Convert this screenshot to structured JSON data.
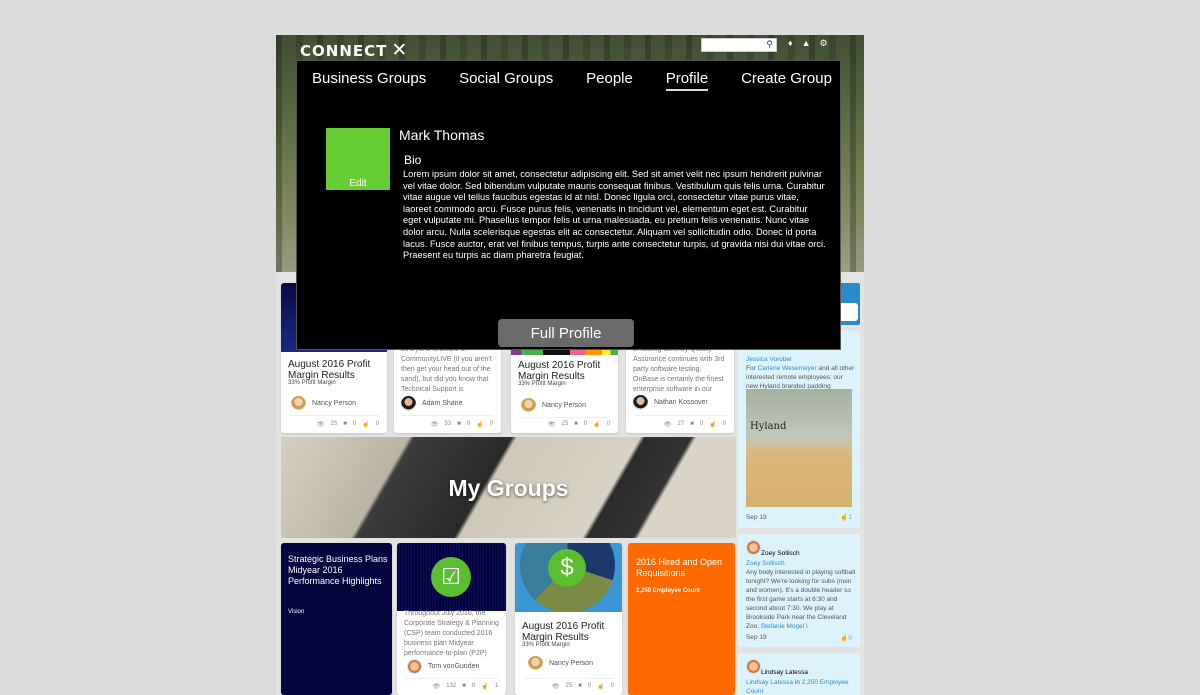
{
  "header": {
    "logo": "CONNECT",
    "logo_mark": "✕",
    "search_placeholder": "",
    "icons": [
      "bell-icon",
      "user-icon",
      "gear-icon"
    ]
  },
  "overlay": {
    "nav": [
      {
        "label": "Business Groups",
        "active": false
      },
      {
        "label": "Social Groups",
        "active": false
      },
      {
        "label": "People",
        "active": false
      },
      {
        "label": "Profile",
        "active": true
      },
      {
        "label": "Create Group",
        "active": false
      }
    ],
    "profile": {
      "photo_edit_label": "Edit",
      "photo_color": "#66cc33",
      "name": "Mark Thomas",
      "bio_label": "Bio",
      "bio": "Lorem ipsum dolor sit amet, consectetur adipiscing elit. Sed sit amet velit nec ipsum hendrerit pulvinar vel vitae dolor. Sed bibendum vulputate mauris consequat finibus. Vestibulum quis felis urna. Curabitur vitae augue vel tellus faucibus egestas id at nisl. Donec ligula orci, consectetur vitae purus vitae, laoreet commodo arcu. Fusce purus felis, venenatis in tincidunt vel, elementum eget est. Curabitur eget vulputate mi. Phasellus tempor felis ut urna malesuada, eu pretium felis venenatis. Nunc vitae dolor arcu. Nulla scelerisque egestas elit ac consectetur. Aliquam vel sollicitudin odio. Donec id porta lacus. Fusce auctor, erat vel finibus tempus, turpis ante consectetur turpis, ut gravida nisi dui vitae orci. Praesent eu turpis ac diam pharetra feugiat."
    },
    "full_profile_label": "Full Profile"
  },
  "row1": [
    {
      "title": "August 2016 Profit Margin Results",
      "subtitle": "33% Profit Margin",
      "excerpt": "",
      "author": "Nancy Person",
      "views": "25",
      "comments": "0",
      "likes": "0"
    },
    {
      "title": "",
      "subtitle": "",
      "excerpt": "Everyone is aware of CommunityLIVE (if you aren't then get your head out of the sand), but did you know that Technical Support is",
      "author": "Adam Shane",
      "views": "53",
      "comments": "0",
      "likes": "0"
    },
    {
      "title": "August 2016 Profit Margin Results",
      "subtitle": "33% Profit Margin",
      "excerpt": "",
      "author": "Nancy Person",
      "views": "25",
      "comments": "0",
      "likes": "0"
    },
    {
      "title": "",
      "subtitle": "",
      "excerpt": "of testing done by Quality Assurance continues with 3rd party software testing. OnBase is certainly the finest enterprise software in our",
      "author": "Nathan Kossover",
      "views": "27",
      "comments": "0",
      "likes": "0"
    }
  ],
  "my_groups": {
    "label": "My Groups"
  },
  "row2": [
    {
      "title": "Strategic Business Plans Midyear 2016 Performance Highlights",
      "subtitle": "Vision",
      "color": "#05053d"
    },
    {
      "excerpt": "Throughout July 2016, the Corporate Strategy & Planning (CSP) team conducted 2016 business plan Midyear performance-to-plan (P2P)",
      "author": "Tom vonGunden",
      "views": "132",
      "comments": "0",
      "likes": "1"
    },
    {
      "title": "August 2016 Profit Margin Results",
      "subtitle": "33% Profit Margin",
      "author": "Nancy Person",
      "views": "25",
      "comments": "0",
      "likes": "0"
    },
    {
      "title": "2016 Hired and Open Requisitions",
      "subtitle": "2,250 Employee Count",
      "color": "#ff6a00"
    }
  ],
  "feed": [
    {
      "author": "Jessica Vorobel",
      "prefix": "For",
      "mention": "Carlene Wesemeyer",
      "text": " and all other interested remote employees: our new Hyland branded padding",
      "date": "Sep 19",
      "likes": "1",
      "image_caption": "Hyland"
    },
    {
      "header_name": "Zoey Sollisch",
      "author": "Zoey Sollisch",
      "text": "Any body interested in playing softball tonight? We're looking for subs (men and women). It's a double header so the first game starts at 6:30 and second about 7:30. We play at Brookside Park near the Cleveland Zoo.",
      "mention": "Stefanie Mogel \\",
      "date": "Sep 19",
      "likes": "0"
    },
    {
      "header_name": "Lindsay Latessa",
      "author": "Lindsay Latessa",
      "in_label": "in",
      "group": "2,250 Employee Count"
    }
  ]
}
